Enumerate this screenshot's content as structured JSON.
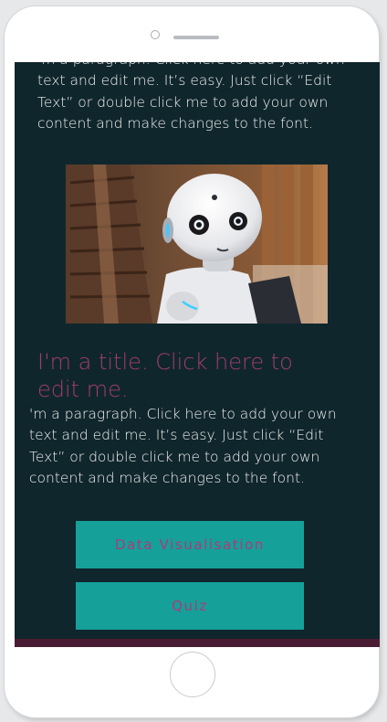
{
  "content": {
    "top_paragraph": "'m a paragraph. Click here to add your own text and edit me. It’s easy. Just click “Edit Text” or double click me to add your own content and make changes to the font.",
    "title": "I'm a title. Click here to edit me.",
    "paragraph": "'m a paragraph. Click here to add your own text and edit me. It’s easy. Just click “Edit Text” or double click me to add your own content and make changes to the font."
  },
  "buttons": {
    "data_visualisation": "Data Visualisation",
    "quiz": "Quiz"
  },
  "colors": {
    "screen_background": "#10262d",
    "title": "#a03d6f",
    "button_background": "#16a09a",
    "button_text": "#a93d78",
    "bottom_bar": "#4a1c33"
  },
  "icons": {
    "camera": "camera-icon",
    "home_button": "home-button-icon"
  }
}
